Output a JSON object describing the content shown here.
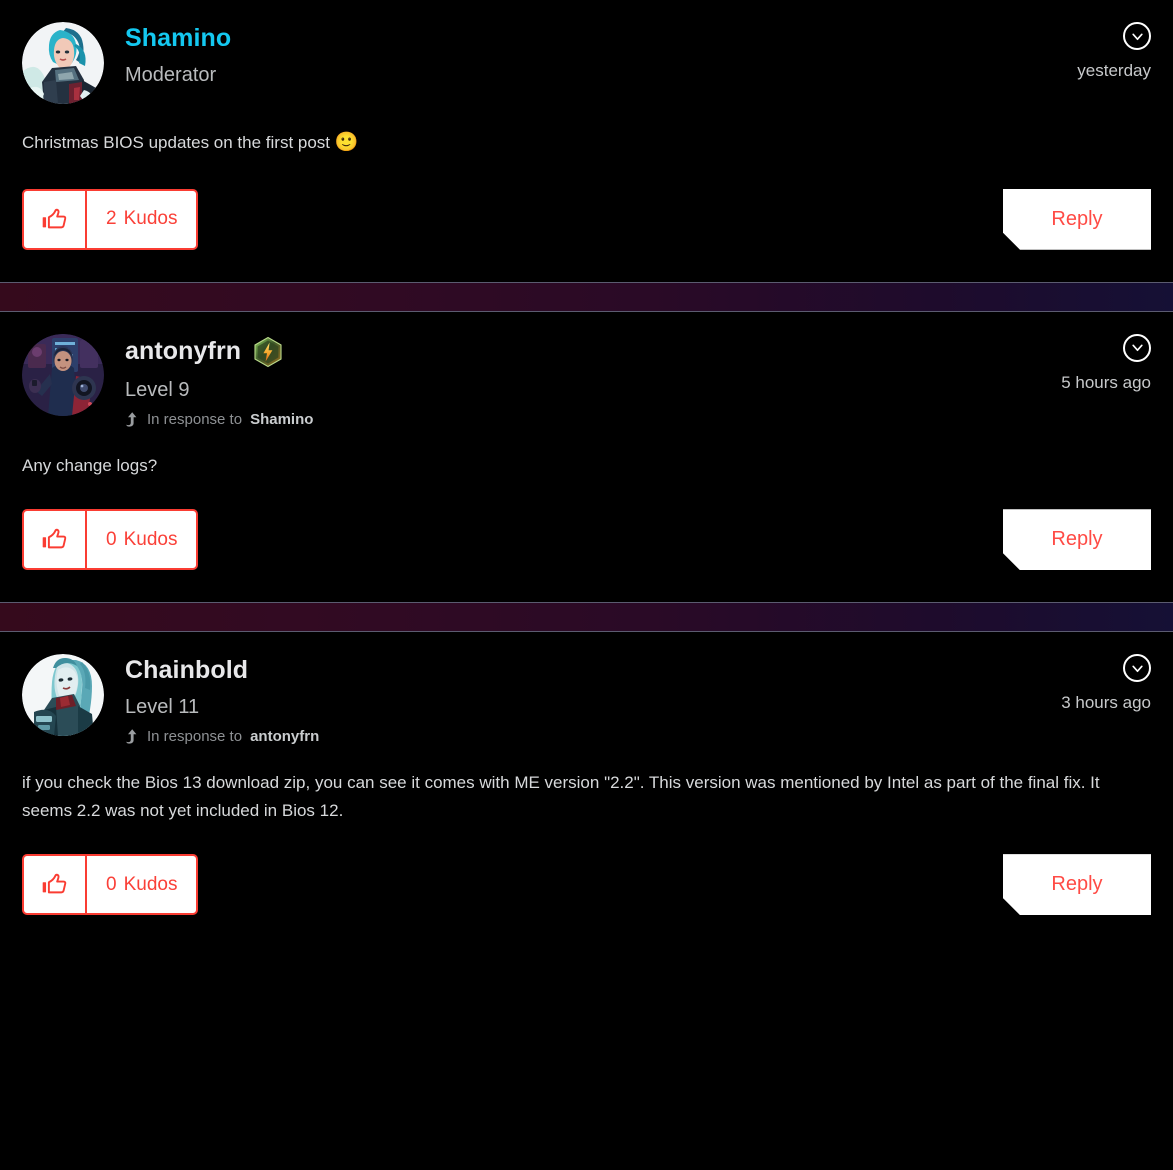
{
  "theme": {
    "background": "#000000",
    "accent_red": "#fa3c32",
    "link_cyan": "#14c8f0",
    "body_text": "#d7d9db"
  },
  "posts": [
    {
      "author": "Shamino",
      "author_color": "cyan",
      "rank": "Moderator",
      "has_badge": false,
      "in_response_to": null,
      "timestamp": "yesterday",
      "body": "Christmas BIOS updates on the first post ",
      "emoji": "🙂",
      "kudos_count": "2",
      "kudos_label": "Kudos",
      "reply_label": "Reply",
      "avatar_name": "avatar-shamino",
      "options_icon": "chevron-down-circle-icon"
    },
    {
      "author": "antonyfrn",
      "author_color": "white",
      "rank": "Level 9",
      "has_badge": true,
      "badge_icon": "lightning-hex-badge-icon",
      "in_response_prefix": "In response to",
      "in_response_to": "Shamino",
      "timestamp": "5 hours ago",
      "body": "Any change logs?",
      "emoji": "",
      "kudos_count": "0",
      "kudos_label": "Kudos",
      "reply_label": "Reply",
      "avatar_name": "avatar-antonyfrn",
      "options_icon": "chevron-down-circle-icon"
    },
    {
      "author": "Chainbold",
      "author_color": "white",
      "rank": "Level 11",
      "has_badge": false,
      "in_response_prefix": "In response to",
      "in_response_to": "antonyfrn",
      "timestamp": "3 hours ago",
      "body": "if you check the Bios 13 download zip, you can see it comes with ME version \"2.2\".  This version was mentioned by Intel as part of the final fix. It seems 2.2 was not yet included in Bios 12.",
      "emoji": "",
      "kudos_count": "0",
      "kudos_label": "Kudos",
      "reply_label": "Reply",
      "avatar_name": "avatar-chainbold",
      "options_icon": "chevron-down-circle-icon"
    }
  ]
}
